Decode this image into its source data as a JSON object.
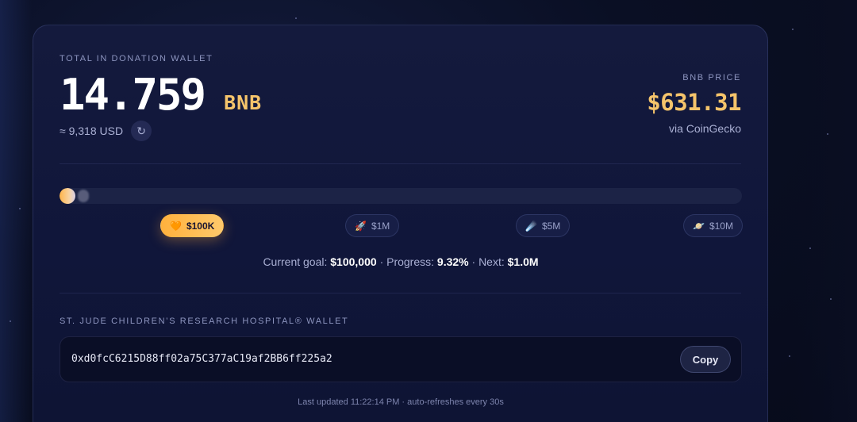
{
  "wallet_total": {
    "label": "TOTAL IN DONATION WALLET",
    "amount": "14.759",
    "unit": "BNB",
    "usd_equivalent": "≈ 9,318 USD",
    "refresh_icon": "↻"
  },
  "price": {
    "label": "BNB PRICE",
    "value": "$631.31",
    "source": "via CoinGecko"
  },
  "progress": {
    "fraction": 0.0093
  },
  "milestones": [
    {
      "icon": "🧡",
      "icon_name": "orange-heart-icon",
      "label": "$100K",
      "active": true
    },
    {
      "icon": "🚀",
      "icon_name": "rocket-icon",
      "label": "$1M",
      "active": false
    },
    {
      "icon": "☄️",
      "icon_name": "comet-icon",
      "label": "$5M",
      "active": false
    },
    {
      "icon": "🪐",
      "icon_name": "planet-icon",
      "label": "$10M",
      "active": false
    }
  ],
  "goal": {
    "current_label": "Current goal:",
    "current_value": "$100,000",
    "progress_label": "· Progress:",
    "progress_value": "9.32%",
    "next_label": "· Next:",
    "next_value": "$1.0M"
  },
  "wallet": {
    "label": "ST. JUDE CHILDREN’S RESEARCH HOSPITAL® WALLET",
    "address": "0xd0fcC6215D88ff02a75C377aC19af2BB6ff225a2",
    "copy_label": "Copy"
  },
  "footer": {
    "updated": "Last updated 11:22:14 PM · auto-refreshes every 30s"
  },
  "colors": {
    "accent": "#f5c46b",
    "active_milestone": "#ffb13d",
    "background": "#0a0f24"
  }
}
